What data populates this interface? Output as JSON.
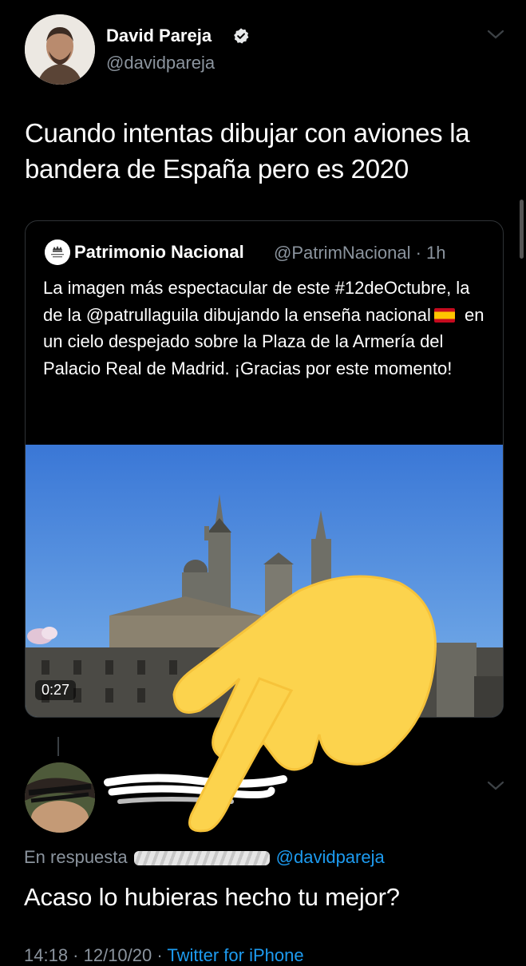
{
  "tweet": {
    "author_name": "David Pareja",
    "author_handle": "@davidpareja",
    "text": "Cuando intentas dibujar con aviones la bandera de España pero es 2020",
    "icons": {
      "verified": "verified-badge-icon",
      "more": "chevron-down-icon"
    }
  },
  "quote": {
    "author_name": "Patrimonio Nacional",
    "meta": "@PatrimNacional · 1h",
    "text_part1": "La imagen más espectacular de este #12deOctubre, la de la @patrullaguila dibujando la enseña nacional",
    "text_part2": " en un cielo despejado sobre la Plaza de la Armería del Palacio Real de Madrid. ¡Gracias por este momento!",
    "flag_icon": "spain-flag-icon",
    "video_duration": "0:27"
  },
  "reply": {
    "context_prefix": "En respuesta",
    "mention": "@davidpareja",
    "text": "Acaso lo hubieras hecho tu mejor?",
    "footer_time": "14:18 · 12/10/20 ·",
    "footer_source": "Twitter for iPhone"
  },
  "colors": {
    "background": "#000000",
    "link": "#1d9bf0",
    "secondary_text": "#8b949e"
  }
}
